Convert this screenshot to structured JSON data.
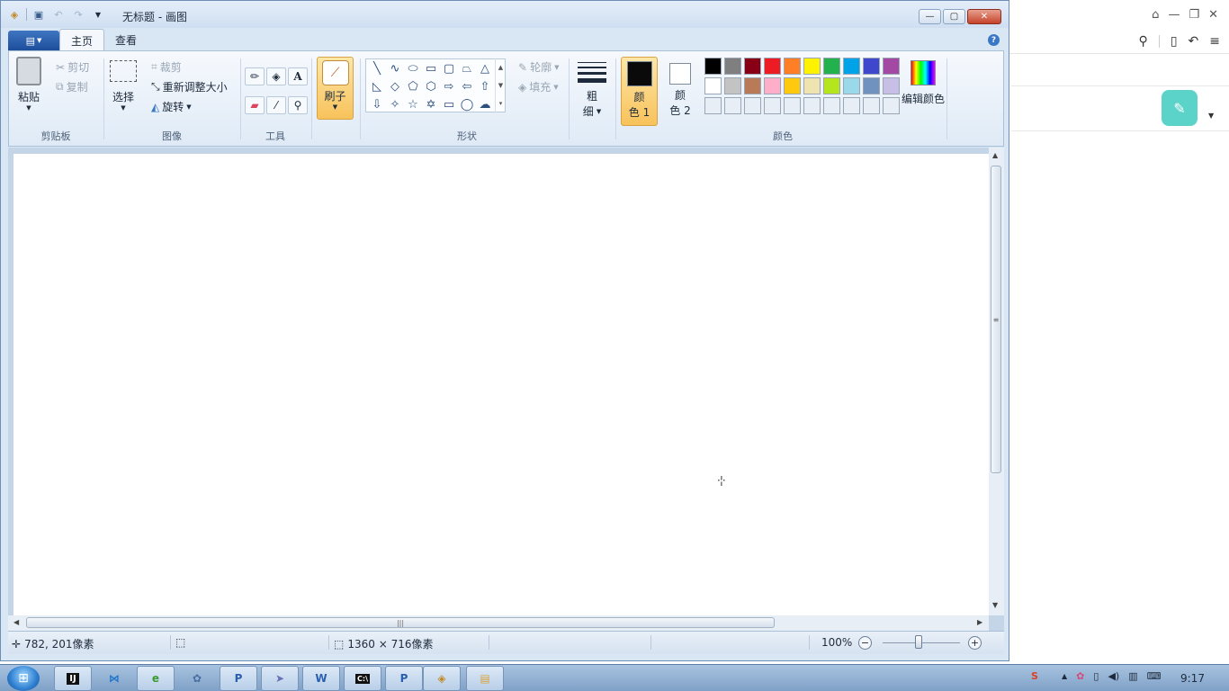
{
  "window": {
    "title": "无标题 - 画图"
  },
  "tabs": [
    "主页",
    "查看"
  ],
  "ribbon": {
    "clipboard": {
      "paste": "粘贴",
      "cut": "剪切",
      "copy": "复制",
      "label": "剪贴板"
    },
    "image": {
      "select": "选择",
      "crop": "裁剪",
      "resize": "重新调整大小",
      "rotate": "旋转",
      "label": "图像"
    },
    "tools": {
      "label": "工具"
    },
    "brushes": {
      "label": "刷子"
    },
    "shapes": {
      "outline": "轮廓",
      "fill": "填充",
      "label": "形状"
    },
    "size": {
      "label_top": "粗",
      "label_bottom": "细"
    },
    "colors": {
      "color1_top": "颜",
      "color1_bottom": "色 1",
      "color2_top": "颜",
      "color2_bottom": "色 2",
      "edit": "编辑颜色",
      "label": "颜色",
      "color1_value": "#0a0a0a",
      "color2_value": "#ffffff",
      "palette_row1": [
        "#000000",
        "#7f7f7f",
        "#880015",
        "#ed1c24",
        "#ff7f27",
        "#fff200",
        "#22b14c",
        "#00a2e8",
        "#3f48cc",
        "#a349a4"
      ],
      "palette_row2": [
        "#ffffff",
        "#c3c3c3",
        "#b97a57",
        "#ffaec9",
        "#ffc90e",
        "#efe4b0",
        "#b5e61d",
        "#99d9ea",
        "#7092be",
        "#c8bfe7"
      ],
      "palette_row3": [
        "#e8eef5",
        "#e8eef5",
        "#e8eef5",
        "#e8eef5",
        "#e8eef5",
        "#e8eef5",
        "#e8eef5",
        "#e8eef5",
        "#e8eef5",
        "#e8eef5"
      ]
    }
  },
  "status": {
    "cursor_pos": "782, 201像素",
    "image_size": "1360 × 716像素",
    "zoom": "100%"
  },
  "taskbar": {
    "clock": "9:17",
    "apps": [
      "intellij",
      "vscode",
      "ie",
      "settings",
      "pycharm-1",
      "feather",
      "word",
      "cmd",
      "pycharm-2",
      "paint",
      "explorer"
    ]
  }
}
